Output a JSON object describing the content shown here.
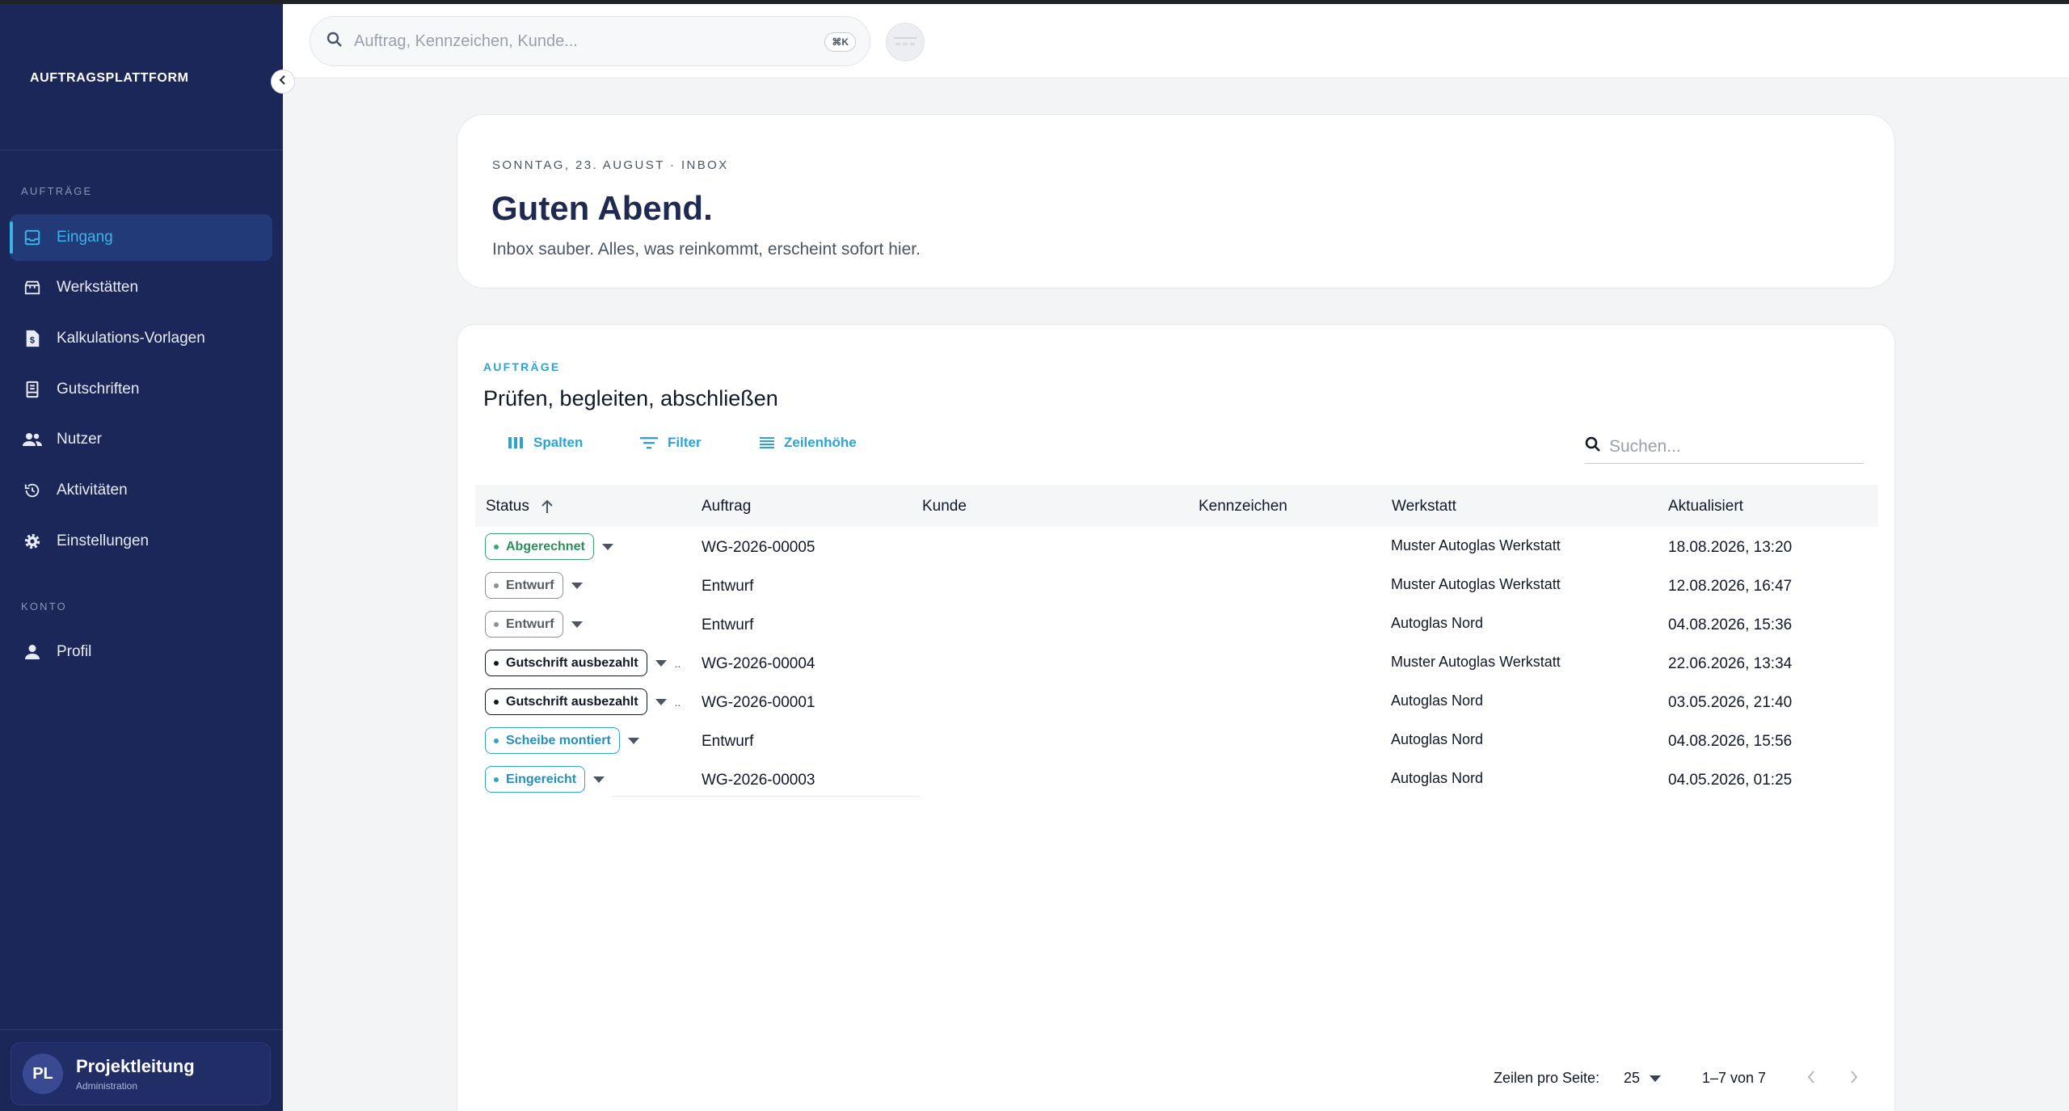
{
  "sidebar": {
    "brand": "AUFTRAGSPLATTFORM",
    "section_orders": "AUFTRÄGE",
    "section_account": "KONTO",
    "items": [
      {
        "label": "Eingang",
        "icon": "inbox-icon"
      },
      {
        "label": "Werkstätten",
        "icon": "store-icon"
      },
      {
        "label": "Kalkulations-Vorlagen",
        "icon": "document-dollar-icon"
      },
      {
        "label": "Gutschriften",
        "icon": "receipt-icon"
      },
      {
        "label": "Nutzer",
        "icon": "users-icon"
      },
      {
        "label": "Aktivitäten",
        "icon": "history-icon"
      },
      {
        "label": "Einstellungen",
        "icon": "gear-icon"
      }
    ],
    "account_items": [
      {
        "label": "Profil",
        "icon": "person-icon"
      }
    ],
    "user": {
      "initials": "PL",
      "name": "Projektleitung",
      "role": "Administration"
    }
  },
  "header": {
    "search_placeholder": "Auftrag, Kennzeichen, Kunde...",
    "shortcut": "⌘K"
  },
  "hero": {
    "date_line": "SONNTAG, 23. AUGUST · INBOX",
    "title": "Guten Abend.",
    "subtitle": "Inbox sauber. Alles, was reinkommt, erscheint sofort hier."
  },
  "orders": {
    "kicker": "AUFTRÄGE",
    "title": "Prüfen, begleiten, abschließen",
    "toolbar": {
      "columns": "Spalten",
      "filter": "Filter",
      "density": "Zeilenhöhe"
    },
    "search_placeholder": "Suchen...",
    "columns": [
      "Status",
      "Auftrag",
      "Kunde",
      "Kennzeichen",
      "Werkstatt",
      "Aktualisiert"
    ],
    "rows": [
      {
        "status": "Abgerechnet",
        "variant": "green",
        "auftrag": "WG-2026-00005",
        "kunde": "",
        "kennzeichen": "",
        "werkstatt": "Muster Autoglas Werkstatt",
        "aktualisiert": "18.08.2026, 13:20",
        "more": ""
      },
      {
        "status": "Entwurf",
        "variant": "gray",
        "auftrag": "Entwurf",
        "kunde": "",
        "kennzeichen": "",
        "werkstatt": "Muster Autoglas Werkstatt",
        "aktualisiert": "12.08.2026, 16:47",
        "more": ""
      },
      {
        "status": "Entwurf",
        "variant": "gray",
        "auftrag": "Entwurf",
        "kunde": "",
        "kennzeichen": "",
        "werkstatt": "Autoglas Nord",
        "aktualisiert": "04.08.2026, 15:36",
        "more": ""
      },
      {
        "status": "Gutschrift ausbezahlt",
        "variant": "black",
        "auftrag": "WG-2026-00004",
        "kunde": "",
        "kennzeichen": "",
        "werkstatt": "Muster Autoglas Werkstatt",
        "aktualisiert": "22.06.2026, 13:34",
        "more": ".."
      },
      {
        "status": "Gutschrift ausbezahlt",
        "variant": "black",
        "auftrag": "WG-2026-00001",
        "kunde": "",
        "kennzeichen": "",
        "werkstatt": "Autoglas Nord",
        "aktualisiert": "03.05.2026, 21:40",
        "more": ".."
      },
      {
        "status": "Scheibe montiert",
        "variant": "blue",
        "auftrag": "Entwurf",
        "kunde": "",
        "kennzeichen": "",
        "werkstatt": "Autoglas Nord",
        "aktualisiert": "04.08.2026, 15:56",
        "more": ""
      },
      {
        "status": "Eingereicht",
        "variant": "blue",
        "auftrag": "WG-2026-00003",
        "kunde": "",
        "kennzeichen": "",
        "werkstatt": "Autoglas Nord",
        "aktualisiert": "04.05.2026, 01:25",
        "more": ""
      }
    ],
    "pagination": {
      "rows_label": "Zeilen pro Seite:",
      "rows_value": "25",
      "range": "1–7 von 7"
    }
  },
  "colors": {
    "sidebar_bg": "#1b2659",
    "accent": "#2ea3d1",
    "success": "#3aa56d"
  }
}
